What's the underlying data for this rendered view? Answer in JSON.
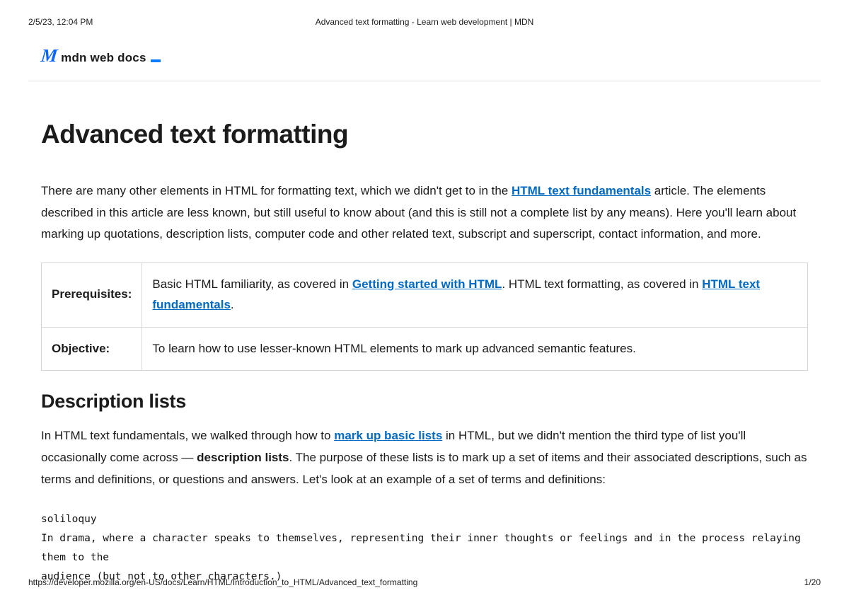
{
  "print": {
    "timestamp": "2/5/23, 12:04 PM",
    "doc_title": "Advanced text formatting - Learn web development | MDN",
    "url": "https://developer.mozilla.org/en-US/docs/Learn/HTML/Introduction_to_HTML/Advanced_text_formatting",
    "page_indicator": "1/20"
  },
  "logo": {
    "glyph": "M",
    "text": "mdn web docs"
  },
  "article": {
    "title": "Advanced text formatting",
    "intro_a": "There are many other elements in HTML for formatting text, which we didn't get to in the ",
    "intro_link": "HTML text fundamentals",
    "intro_b": " article. The elements described in this article are less known, but still useful to know about (and this is still not a complete list by any means). Here you'll learn about marking up quotations, description lists, computer code and other related text, subscript and superscript, contact information, and more.",
    "table": {
      "row1_label": "Prerequisites:",
      "row1_a": "Basic HTML familiarity, as covered in ",
      "row1_link1": "Getting started with HTML",
      "row1_b": ". HTML text formatting, as covered in ",
      "row1_link2": "HTML text fundamentals",
      "row1_c": ".",
      "row2_label": "Objective:",
      "row2_val": "To learn how to use lesser-known HTML elements to mark up advanced semantic features."
    },
    "h2": "Description lists",
    "p2_a": "In HTML text fundamentals, we walked through how to ",
    "p2_link": "mark up basic lists",
    "p2_b": " in HTML, but we didn't mention the third type of list you'll occasionally come across — ",
    "p2_strong": "description lists",
    "p2_c": ". The purpose of these lists is to mark up a set of items and their associated descriptions, such as terms and definitions, or questions and answers. Let's look at an example of a set of terms and definitions:",
    "code": "soliloquy\nIn drama, where a character speaks to themselves, representing their inner thoughts or feelings and in the process relaying them to the\naudience (but not to other characters.)"
  }
}
